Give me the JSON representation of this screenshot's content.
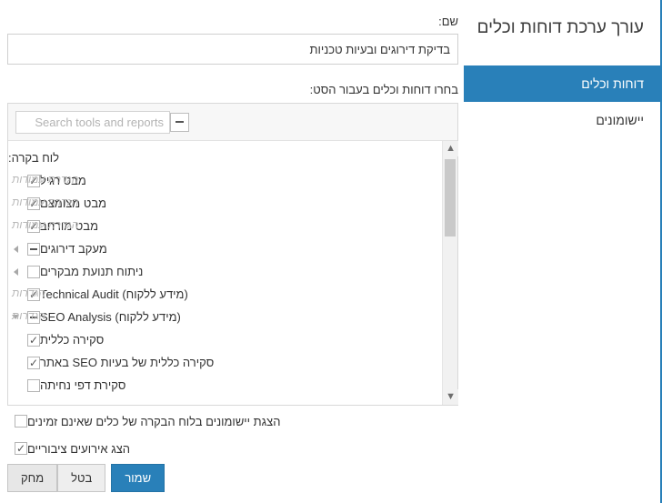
{
  "nav": {
    "title": "עורך ערכת דוחות וכלים",
    "items": [
      {
        "label": "דוחות וכלים",
        "active": true
      },
      {
        "label": "יישומונים",
        "active": false
      }
    ],
    "accent_color": "#2980b9"
  },
  "form": {
    "name_label": "שם:",
    "name_value": "בדיקת דירוגים ובעיות טכניות",
    "name_placeholder": "",
    "picker_label": "בחרו דוחות וכלים בעבור הסט:",
    "search_placeholder": "Search tools and reports",
    "search_value": "",
    "collapse_all_icon": "minus-icon"
  },
  "tree": {
    "group_header": "לוח בקרה:",
    "rows": [
      {
        "label": "מבט רגיל",
        "state": "checked",
        "arrow": "none",
        "indent": 1,
        "link": "הגדרת עמודות"
      },
      {
        "label": "מבט מצומצם",
        "state": "checked",
        "arrow": "none",
        "indent": 1,
        "link": "הגדרת עמודות"
      },
      {
        "label": "מבט מורחב",
        "state": "checked",
        "arrow": "none",
        "indent": 1,
        "link": "הגדרת עמודות"
      },
      {
        "label": "מעקב דירוגים",
        "state": "indeterminate",
        "arrow": "collapsed",
        "indent": 0,
        "link": ""
      },
      {
        "label": "ניתוח תנועת מבקרים",
        "state": "unchecked",
        "arrow": "collapsed",
        "indent": 0,
        "link": ""
      },
      {
        "label": "Technical Audit (מידע ללקוח)",
        "state": "checked",
        "arrow": "none",
        "indent": 0,
        "link": "הגדרות"
      },
      {
        "label": "SEO Analysis (מידע ללקוח)",
        "state": "indeterminate",
        "arrow": "expanded",
        "indent": 0,
        "link": "הגדרות"
      },
      {
        "label": "סקירה כללית",
        "state": "checked",
        "arrow": "none",
        "indent": 1,
        "link": ""
      },
      {
        "label": "סקירה כללית של בעיות SEO באתר",
        "state": "checked",
        "arrow": "none",
        "indent": 1,
        "link": ""
      },
      {
        "label": "סקירת דפי נחיתה",
        "state": "unchecked",
        "arrow": "none",
        "indent": 1,
        "link": ""
      }
    ],
    "scrollbar": {
      "up_icon": "chevron-up-icon",
      "down_icon": "chevron-down-icon"
    }
  },
  "options": [
    {
      "label": "הצגת יישומונים בלוח הבקרה של כלים שאינם זמינים",
      "state": "unchecked"
    },
    {
      "label": "הצג אירועים ציבוריים",
      "state": "checked"
    }
  ],
  "footer": {
    "delete_label": "מחק",
    "cancel_label": "בטל",
    "save_label": "שמור"
  }
}
